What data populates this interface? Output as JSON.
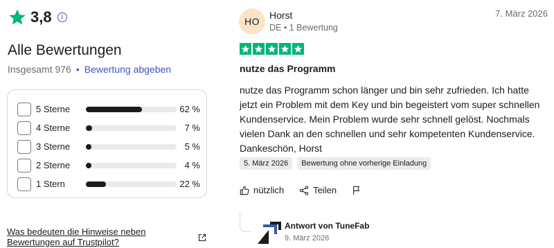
{
  "summary": {
    "rating_value": "3,8",
    "title": "Alle Bewertungen",
    "total_text": "Insgesamt 976",
    "separator": "•",
    "write_review_label": "Bewertung abgeben",
    "accent_color": "#3c57bc",
    "star_color": "#00b67a"
  },
  "distribution": [
    {
      "label": "5 Sterne",
      "percent_text": "62 %",
      "fraction": 0.62
    },
    {
      "label": "4 Sterne",
      "percent_text": "7 %",
      "fraction": 0.07
    },
    {
      "label": "3 Sterne",
      "percent_text": "5 %",
      "fraction": 0.05
    },
    {
      "label": "2 Sterne",
      "percent_text": "4 %",
      "fraction": 0.04
    },
    {
      "label": "1 Stern",
      "percent_text": "22 %",
      "fraction": 0.22
    }
  ],
  "notice_link": "Was bedeuten die Hinweise neben Bewertungen auf Trustpilot?",
  "review": {
    "avatar_initials": "HO",
    "reviewer_name": "Horst",
    "reviewer_meta": "DE • 1 Bewertung",
    "date": "7. März 2026",
    "stars": 5,
    "title": "nutze das Programm",
    "body": "nutze das Programm schon länger und bin sehr zufrieden. Ich hatte jetzt ein Problem mit dem Key und bin begeistert vom super schnellen Kundenservice. Mein Problem wurde sehr schnell gelöst. Nochmals vielen Dank an den schnellen und sehr kompetenten Kundenservice. Dankeschön, Horst",
    "chips": [
      "5. März 2026",
      "Bewertung ohne vorherige Einladung"
    ],
    "actions": {
      "useful_label": "nützlich",
      "share_label": "Teilen"
    }
  },
  "reply": {
    "from": "Antwort von TuneFab",
    "date": "9. März 2026"
  }
}
